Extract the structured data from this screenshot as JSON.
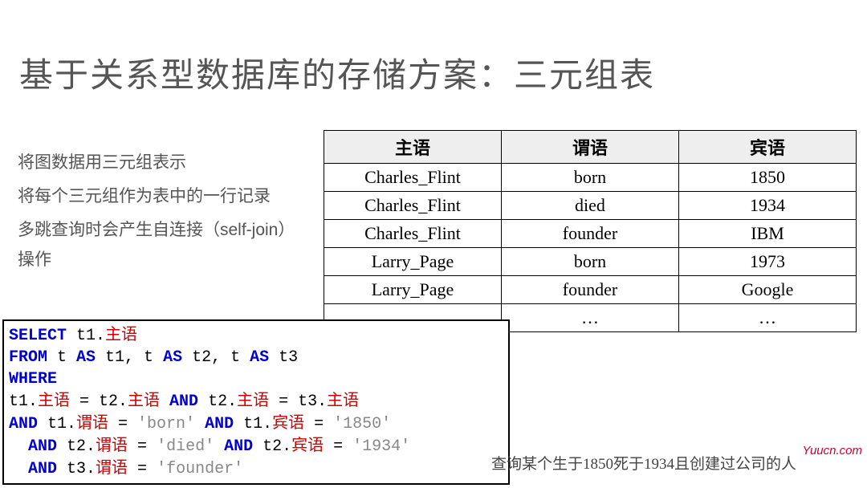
{
  "title": "基于关系型数据库的存储方案：三元组表",
  "bullets": [
    "将图数据用三元组表示",
    "将每个三元组作为表中的一行记录",
    "多跳查询时会产生自连接（self-join）操作"
  ],
  "table": {
    "headers": [
      "主语",
      "谓语",
      "宾语"
    ],
    "rows": [
      [
        "Charles_Flint",
        "born",
        "1850"
      ],
      [
        "Charles_Flint",
        "died",
        "1934"
      ],
      [
        "Charles_Flint",
        "founder",
        "IBM"
      ],
      [
        "Larry_Page",
        "born",
        "1973"
      ],
      [
        "Larry_Page",
        "founder",
        "Google"
      ],
      [
        "…",
        "…",
        "…"
      ]
    ]
  },
  "sql": {
    "kw_select": "SELECT",
    "t1": " t1.",
    "f_subj": "主语",
    "kw_from": "FROM",
    "from_rest": " t ",
    "kw_as": "AS",
    "as_t1": " t1, t ",
    "as_t2": " t2, t ",
    "as_t3": " t3",
    "kw_where": "WHERE",
    "eq1a": "t1.",
    "eq1b": " = t2.",
    "kw_and": "AND",
    "eq2a": " t2.",
    "eq2b": " = t3.",
    "line4a": " t1.",
    "f_pred": "谓语",
    "line4b": " = ",
    "str_born": "'born'",
    "line4c": " t1.",
    "f_obj": "宾语",
    "str_1850": "'1850'",
    "line5a": " t2.",
    "str_died": "'died'",
    "line5b": " t2.",
    "str_1934": "'1934'",
    "line6a": " t3.",
    "str_founder": "'founder'"
  },
  "caption": "查询某个生于1850死于1934且创建过公司的人",
  "watermark": "Yuucn.com"
}
